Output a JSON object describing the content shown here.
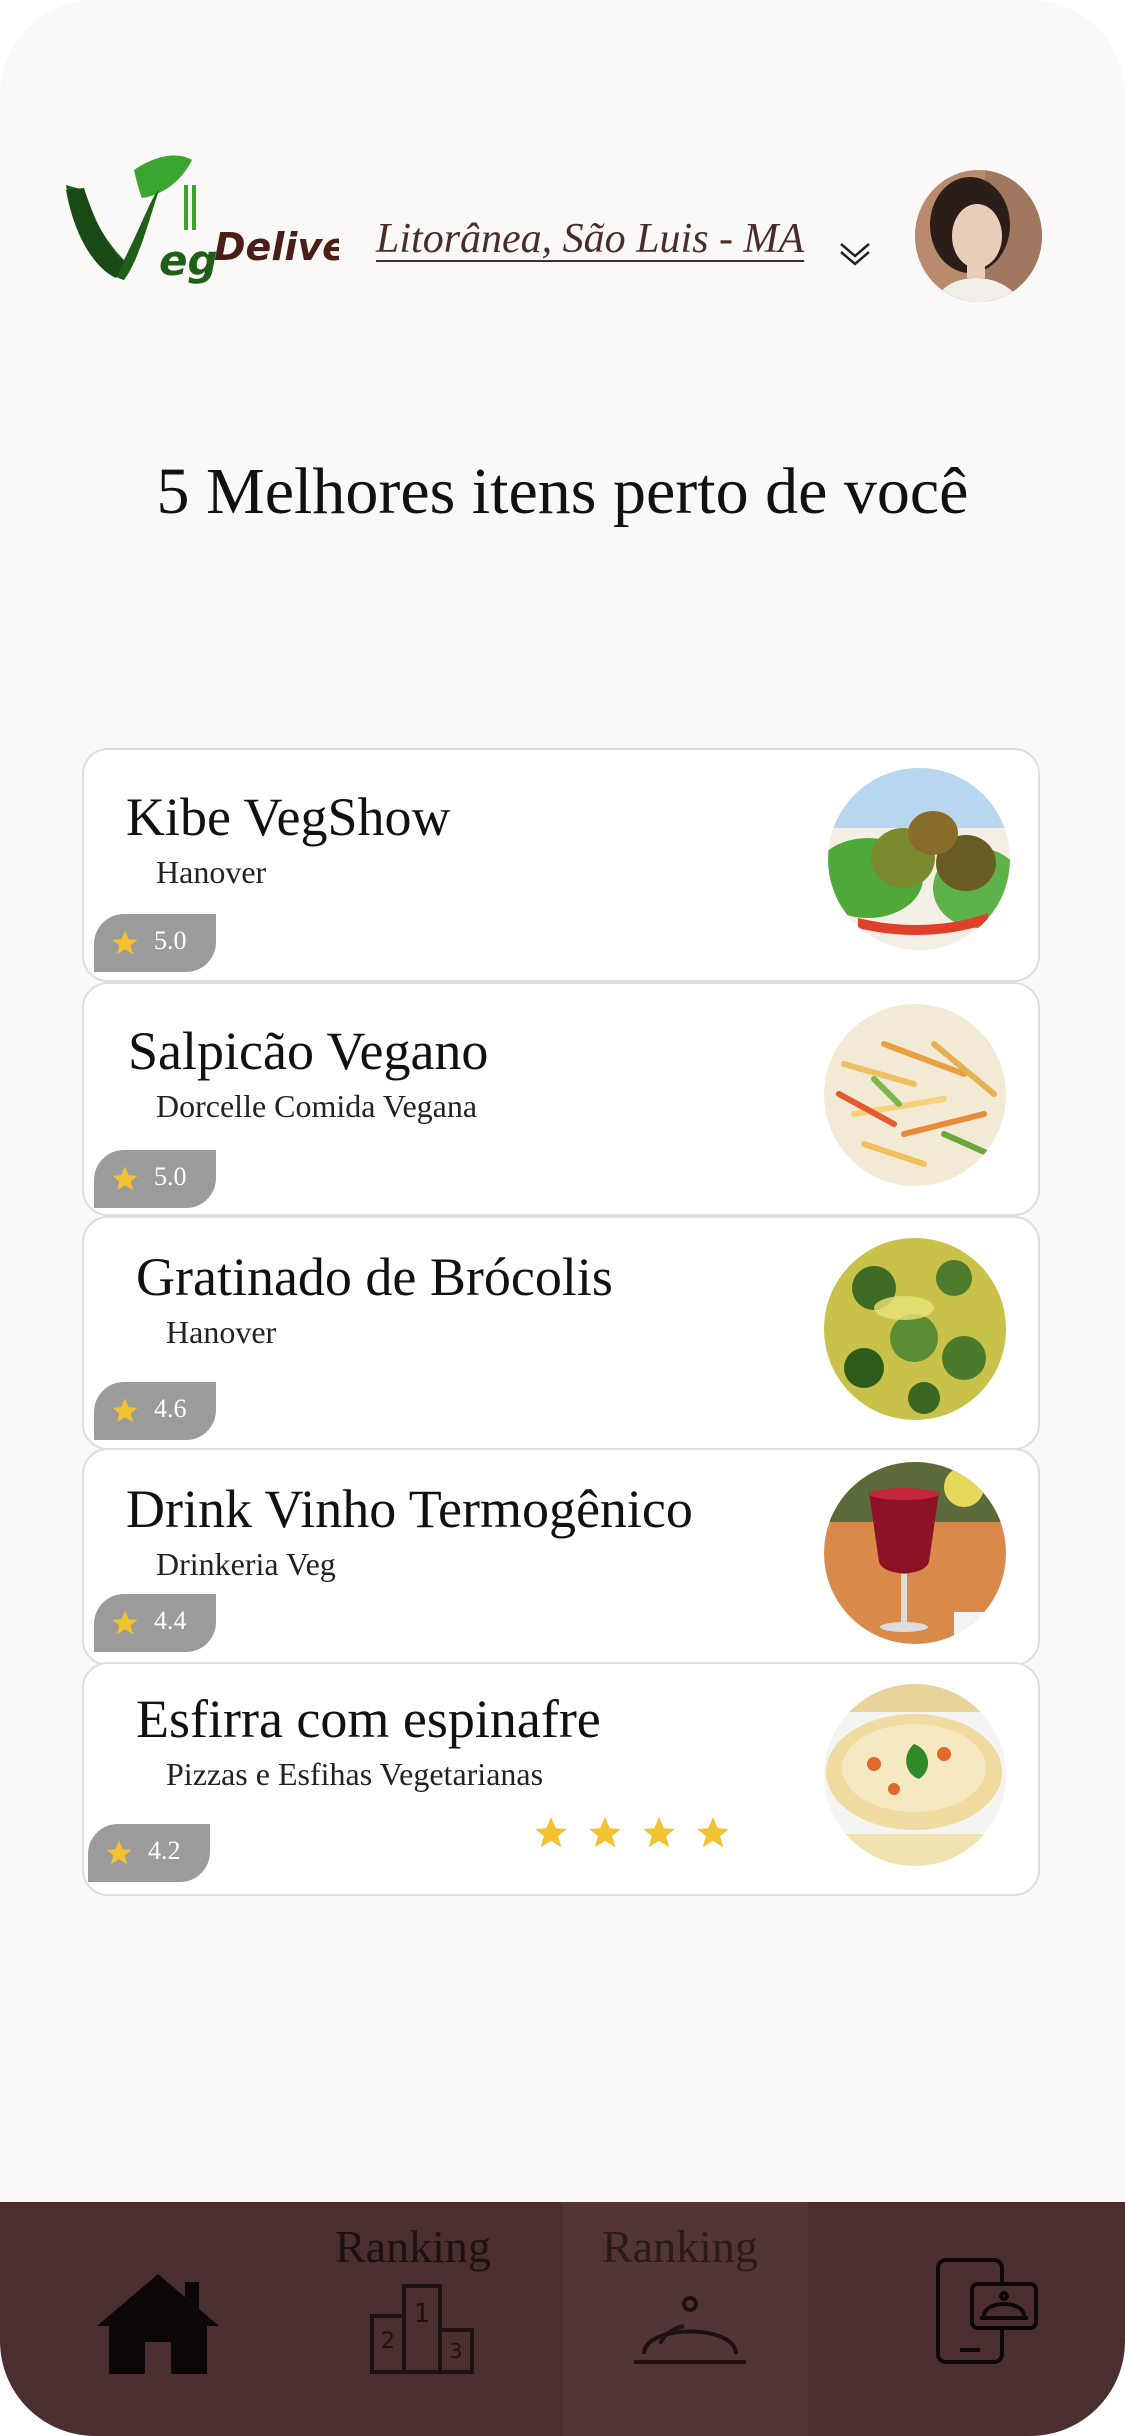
{
  "header": {
    "logo_text": "VeggDelivery",
    "location": "Litorânea, São Luis - MA"
  },
  "page_title": "5 Melhores itens perto de você",
  "items": [
    {
      "name": "Kibe VegShow",
      "store": "Hanover",
      "rating": "5.0"
    },
    {
      "name": "Salpicão Vegano",
      "store": "Dorcelle Comida Vegana",
      "rating": "5.0"
    },
    {
      "name": "Gratinado de Brócolis",
      "store": "Hanover",
      "rating": "4.6"
    },
    {
      "name": "Drink Vinho Termogênico",
      "store": "Drinkeria Veg",
      "rating": "4.4"
    },
    {
      "name": "Esfirra com espinafre",
      "store": "Pizzas e Esfihas Vegetarianas",
      "rating": "4.2",
      "stars_shown": 4
    }
  ],
  "nav": [
    {
      "label": "",
      "icon": "home-icon"
    },
    {
      "label": "Ranking",
      "icon": "podium-icon"
    },
    {
      "label": "Ranking",
      "icon": "food-cloche-icon"
    },
    {
      "label": "",
      "icon": "mobile-order-icon"
    }
  ],
  "colors": {
    "nav_bg": "#4b2f30",
    "star": "#f2c230",
    "rating_badge": "#9b9b9b",
    "logo_green": "#1f5f1a",
    "logo_brown": "#4a1f17"
  }
}
